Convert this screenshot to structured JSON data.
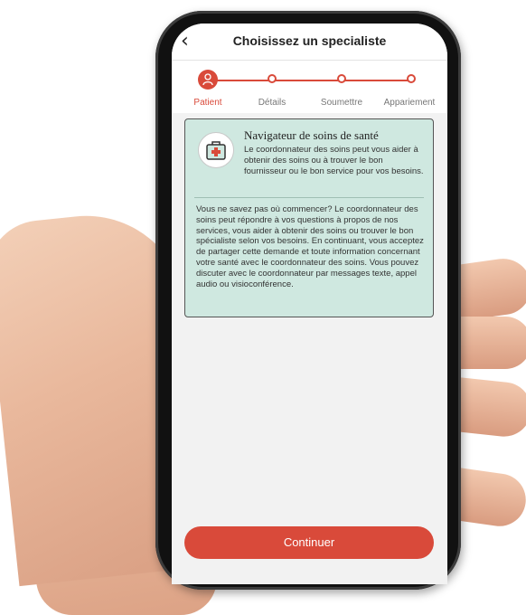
{
  "header": {
    "title": "Choisissez un specialiste",
    "back_icon": "chevron-left-icon"
  },
  "stepper": {
    "steps": [
      {
        "label": "Patient",
        "state": "active"
      },
      {
        "label": "Détails",
        "state": "pending"
      },
      {
        "label": "Soumettre",
        "state": "pending"
      },
      {
        "label": "Appariement",
        "state": "pending"
      }
    ]
  },
  "card": {
    "icon": "first-aid-kit-icon",
    "title": "Navigateur de soins de santé",
    "lead": "Le coordonnateur des soins peut vous aider à obtenir des soins ou à trouver le bon fournisseur ou le bon service pour vos besoins.",
    "body": "Vous ne savez pas où commencer? Le coordonnateur des soins peut répondre à vos questions à propos de nos services, vous aider à obtenir des soins ou trouver le bon spécialiste selon vos besoins. En continuant, vous acceptez de partager cette demande et toute information concernant votre santé avec le coordonnateur des soins. Vous pouvez discuter avec le coordonnateur par messages texte, appel audio ou visioconférence."
  },
  "footer": {
    "continue_label": "Continuer"
  },
  "colors": {
    "accent": "#d94a3a",
    "card_bg": "#cfe8e0",
    "screen_bg": "#f2f2f2"
  }
}
